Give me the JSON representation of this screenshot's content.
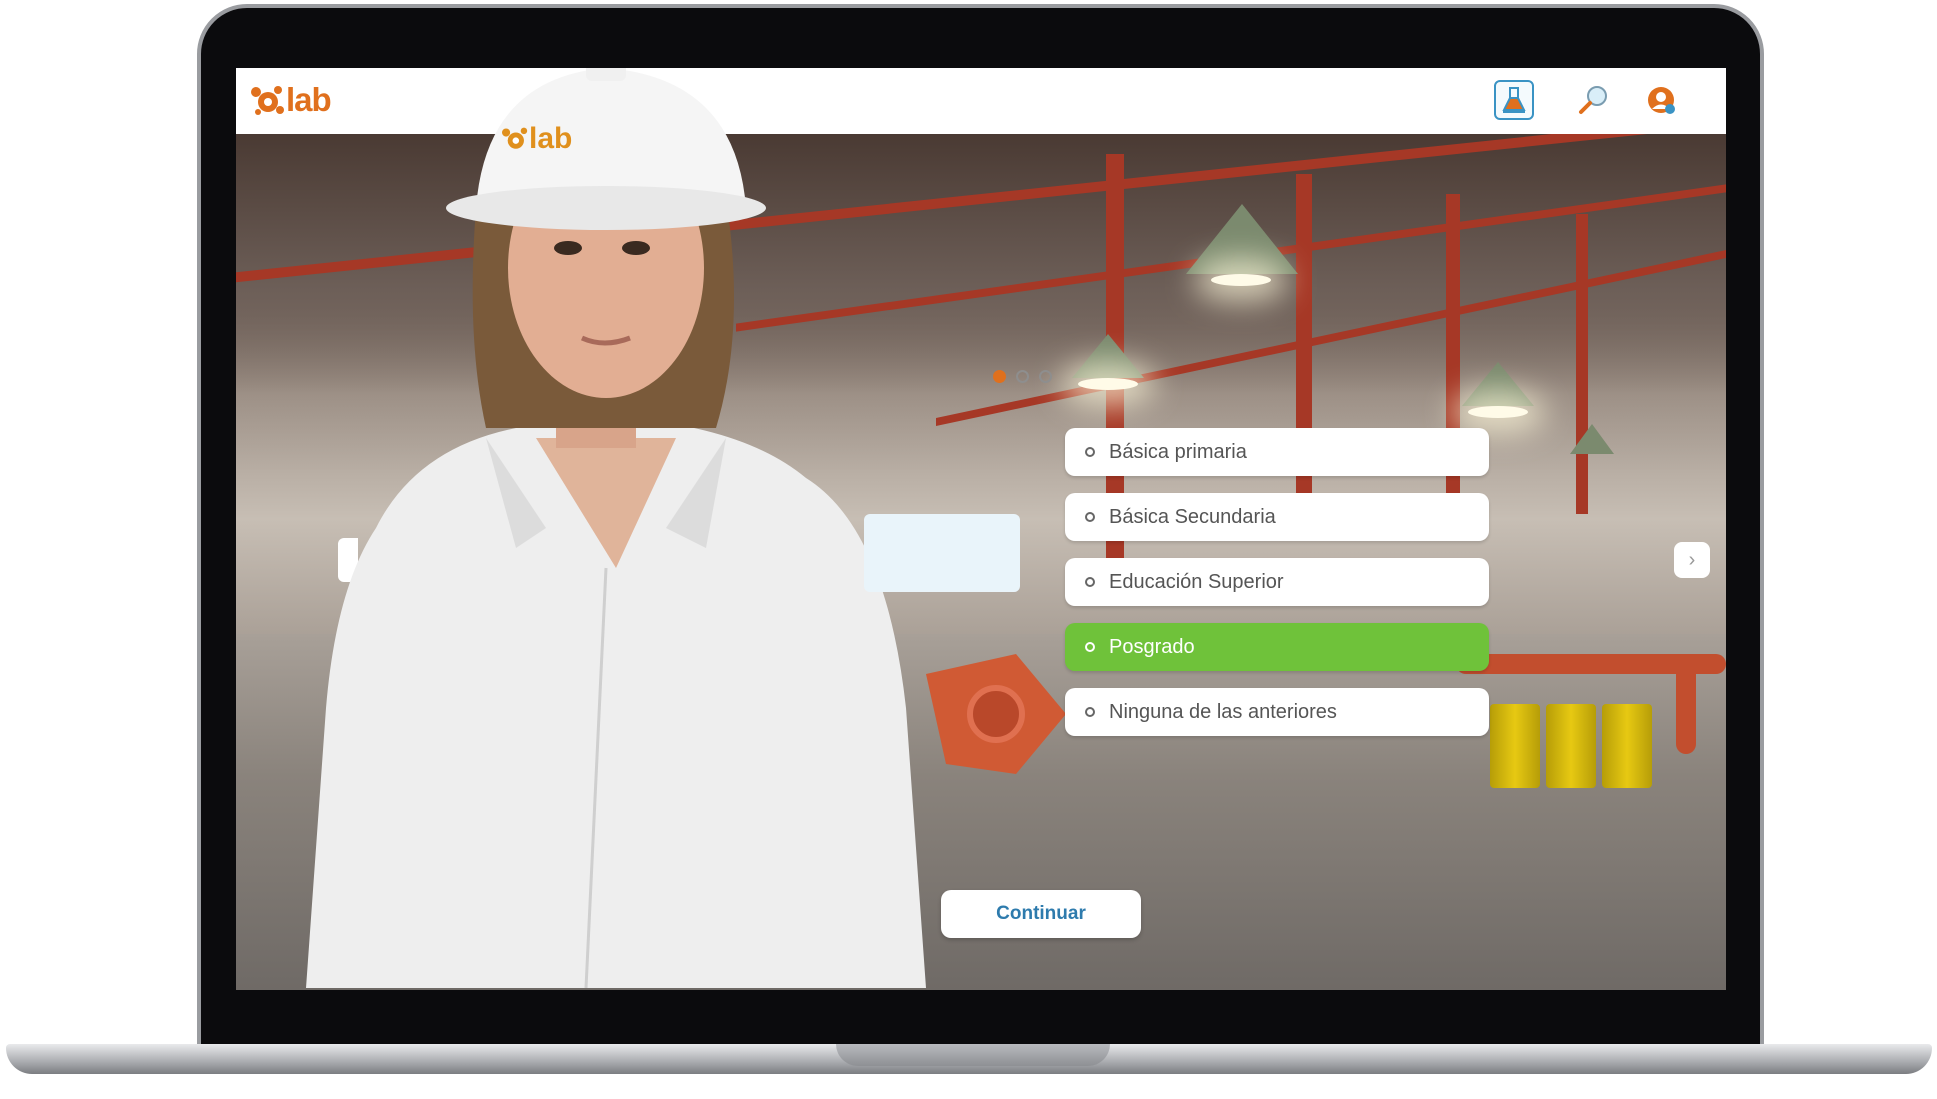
{
  "app": {
    "logo_text": "lab",
    "brand_color": "#e0701d"
  },
  "toolbar": {
    "icons": [
      "lab-flask-icon",
      "search-icon",
      "user-settings-icon"
    ]
  },
  "slides": {
    "total": 3,
    "current": 1
  },
  "helmet_logo_text": "lab",
  "question": {
    "options": [
      {
        "label": "Básica primaria",
        "selected": false
      },
      {
        "label": "Básica Secundaria",
        "selected": false
      },
      {
        "label": "Educación Superior",
        "selected": false
      },
      {
        "label": "Posgrado",
        "selected": true
      },
      {
        "label": "Ninguna de las anteriores",
        "selected": false
      }
    ]
  },
  "continue_label": "Continuar",
  "colors": {
    "selected": "#6fc23a",
    "continue_text": "#2e7bad",
    "active_dot": "#e0701d"
  }
}
